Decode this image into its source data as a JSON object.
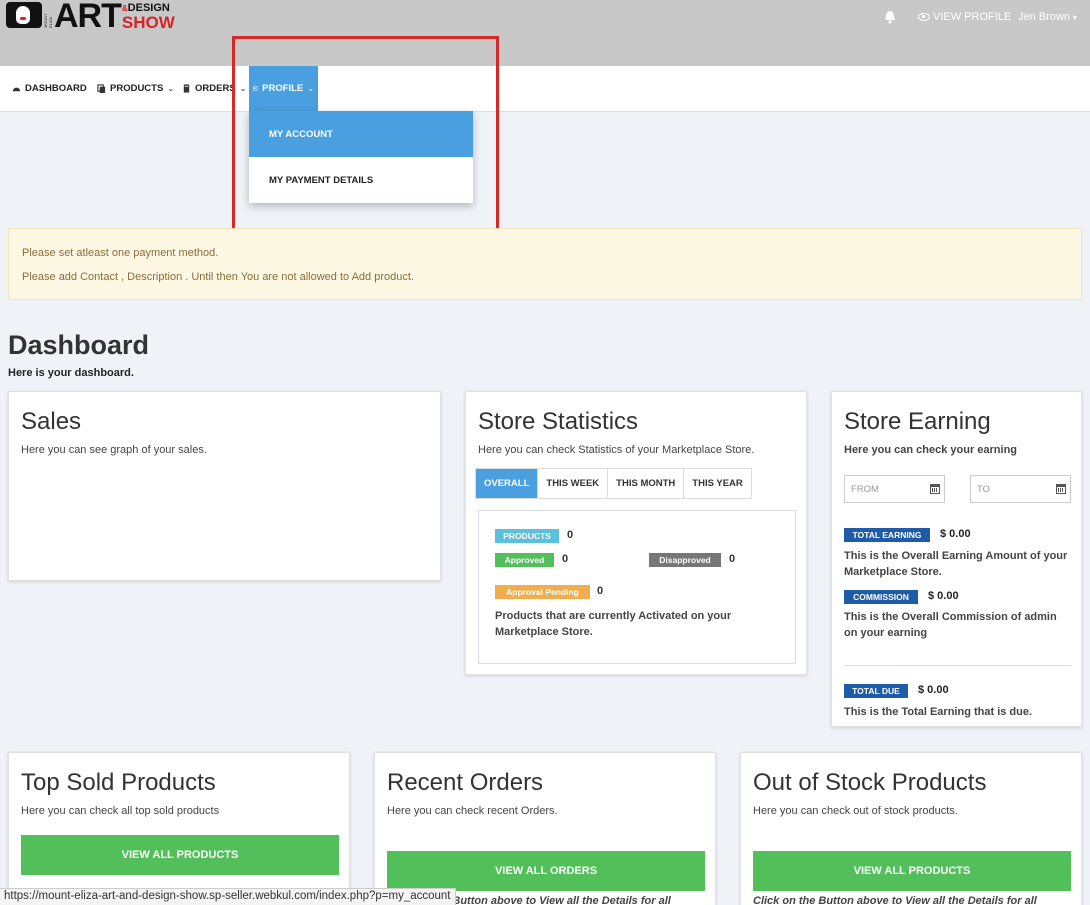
{
  "header": {
    "logo": {
      "art": "ART",
      "design": "DESIGN",
      "amp": "&",
      "show": "SHOW",
      "tiny": "MOUNT ELIZA"
    },
    "bell_icon": "bell-icon",
    "view_profile_label": "VIEW PROFILE",
    "user_name": "Jen Brown"
  },
  "nav": {
    "items": [
      {
        "label": "DASHBOARD",
        "icon": "dashboard-icon",
        "chevron": ""
      },
      {
        "label": "PRODUCTS",
        "icon": "products-icon",
        "chevron": "⌄"
      },
      {
        "label": "ORDERS",
        "icon": "orders-icon",
        "chevron": "⌄"
      },
      {
        "label": "PROFILE",
        "icon": "profile-card-icon",
        "chevron": "⌄"
      }
    ],
    "profile_dropdown": [
      "MY ACCOUNT",
      "MY PAYMENT DETAILS"
    ]
  },
  "alert": {
    "line1": "Please set atleast one payment method.",
    "line2": "Please add Contact , Description . Until then You are not allowed to Add product."
  },
  "dashboard": {
    "title": "Dashboard",
    "subtitle": "Here is your dashboard."
  },
  "sales": {
    "title": "Sales",
    "desc": "Here you can see graph of your sales."
  },
  "store_stats": {
    "title": "Store Statistics",
    "desc": "Here you can check Statistics of your Marketplace Store.",
    "tabs": [
      "OVERALL",
      "THIS WEEK",
      "THIS MONTH",
      "THIS YEAR"
    ],
    "products_label": "PRODUCTS",
    "products_val": "0",
    "approved_label": "Approved",
    "approved_val": "0",
    "disapproved_label": "Disapproved",
    "disapproved_val": "0",
    "pending_label": "Approval Pending",
    "pending_val": "0",
    "note": "Products that are currently Activated on your Marketplace Store."
  },
  "store_earning": {
    "title": "Store Earning",
    "desc": "Here you can check your earning",
    "from_placeholder": "FROM",
    "to_placeholder": "TO",
    "total_label": "TOTAL EARNING",
    "total_val": "$ 0.00",
    "total_text": "This is the Overall Earning Amount of your Marketplace Store.",
    "commission_label": "COMMISSION",
    "commission_val": "$ 0.00",
    "commission_text": "This is the Overall Commission of admin on your earning",
    "due_label": "TOTAL DUE",
    "due_val": "$ 0.00",
    "due_text": "This is the Total Earning that is due."
  },
  "top_sold": {
    "title": "Top Sold Products",
    "desc": "Here you can check all top sold products",
    "button": "VIEW ALL PRODUCTS"
  },
  "recent_orders": {
    "title": "Recent Orders",
    "desc": "Here you can check recent Orders.",
    "button": "VIEW ALL ORDERS",
    "note": "Click on the Button above to View all the Details for all"
  },
  "out_of_stock": {
    "title": "Out of Stock Products",
    "desc": "Here you can check out of stock products.",
    "button": "VIEW ALL PRODUCTS",
    "note": "Click on the Button above to View all the Details for all"
  },
  "status_url": "https://mount-eliza-art-and-design-show.sp-seller.webkul.com/index.php?p=my_account",
  "colors": {
    "primary": "#4a9fe0",
    "green": "#52bf5a",
    "navy": "#1e5ba8",
    "alert_bg": "#fcf8e3",
    "highlight": "#d62a2a"
  }
}
